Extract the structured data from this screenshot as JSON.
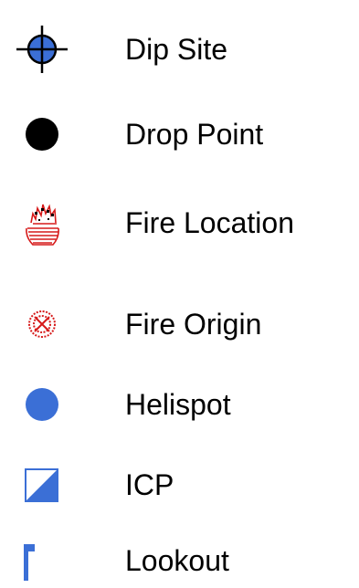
{
  "colors": {
    "blue": "#3b6fd6",
    "black": "#000000",
    "fire_red": "#d61a1a"
  },
  "legend": {
    "items": [
      {
        "label": "Dip Site",
        "icon": "crosshair-circle-icon"
      },
      {
        "label": "Drop Point",
        "icon": "black-circle-icon"
      },
      {
        "label": "Fire Location",
        "icon": "flame-icon"
      },
      {
        "label": "Fire Origin",
        "icon": "fire-origin-icon"
      },
      {
        "label": "Helispot",
        "icon": "blue-circle-icon"
      },
      {
        "label": "ICP",
        "icon": "half-square-icon"
      },
      {
        "label": "Lookout",
        "icon": "flag-icon"
      }
    ]
  }
}
